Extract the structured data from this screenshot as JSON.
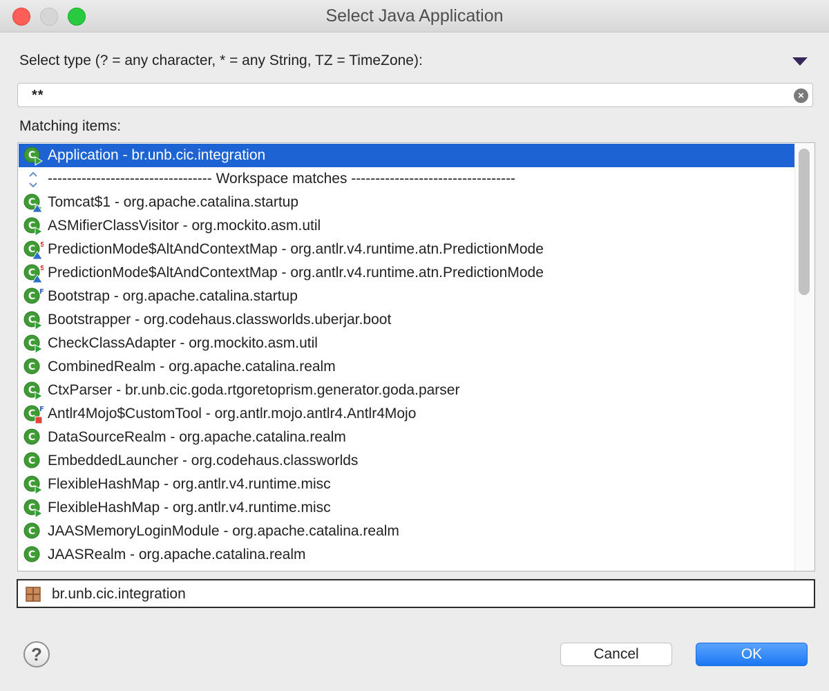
{
  "window": {
    "title": "Select Java Application"
  },
  "filter": {
    "prompt": "Select type (? = any character, * = any String, TZ = TimeZone):",
    "value": "**"
  },
  "matching_label": "Matching items:",
  "items": [
    {
      "label": "Application - br.unb.cic.integration",
      "icon": "class-main-icon",
      "selected": true
    },
    {
      "label": "---------------------------------- Workspace matches ----------------------------------",
      "icon": "separator-icon",
      "separator": true
    },
    {
      "label": "Tomcat$1 - org.apache.catalina.startup",
      "icon": "class-main-abstract-icon"
    },
    {
      "label": "ASMifierClassVisitor - org.mockito.asm.util",
      "icon": "class-main-icon"
    },
    {
      "label": "PredictionMode$AltAndContextMap - org.antlr.v4.runtime.atn.PredictionMode",
      "icon": "class-static-abstract-icon"
    },
    {
      "label": "PredictionMode$AltAndContextMap - org.antlr.v4.runtime.atn.PredictionMode",
      "icon": "class-static-abstract-icon"
    },
    {
      "label": "Bootstrap - org.apache.catalina.startup",
      "icon": "class-final-icon"
    },
    {
      "label": "Bootstrapper - org.codehaus.classworlds.uberjar.boot",
      "icon": "class-main-icon"
    },
    {
      "label": "CheckClassAdapter - org.mockito.asm.util",
      "icon": "class-main-icon"
    },
    {
      "label": "CombinedRealm - org.apache.catalina.realm",
      "icon": "class-icon"
    },
    {
      "label": "CtxParser - br.unb.cic.goda.rtgoretoprism.generator.goda.parser",
      "icon": "class-main-icon"
    },
    {
      "label": "Antlr4Mojo$CustomTool - org.antlr.mojo.antlr4.Antlr4Mojo",
      "icon": "class-final-private-icon"
    },
    {
      "label": "DataSourceRealm - org.apache.catalina.realm",
      "icon": "class-icon"
    },
    {
      "label": "EmbeddedLauncher - org.codehaus.classworlds",
      "icon": "class-icon"
    },
    {
      "label": "FlexibleHashMap - org.antlr.v4.runtime.misc",
      "icon": "class-main-icon"
    },
    {
      "label": "FlexibleHashMap - org.antlr.v4.runtime.misc",
      "icon": "class-main-icon"
    },
    {
      "label": "JAASMemoryLoginModule - org.apache.catalina.realm",
      "icon": "class-icon"
    },
    {
      "label": "JAASRealm - org.apache.catalina.realm",
      "icon": "class-icon"
    }
  ],
  "package": {
    "label": "br.unb.cic.integration",
    "icon": "package-icon"
  },
  "buttons": {
    "cancel": "Cancel",
    "ok": "OK",
    "help": "?"
  },
  "colors": {
    "selection": "#1e63d3",
    "ok_button": "#1b78f2",
    "class_icon": "#3f9c35"
  }
}
